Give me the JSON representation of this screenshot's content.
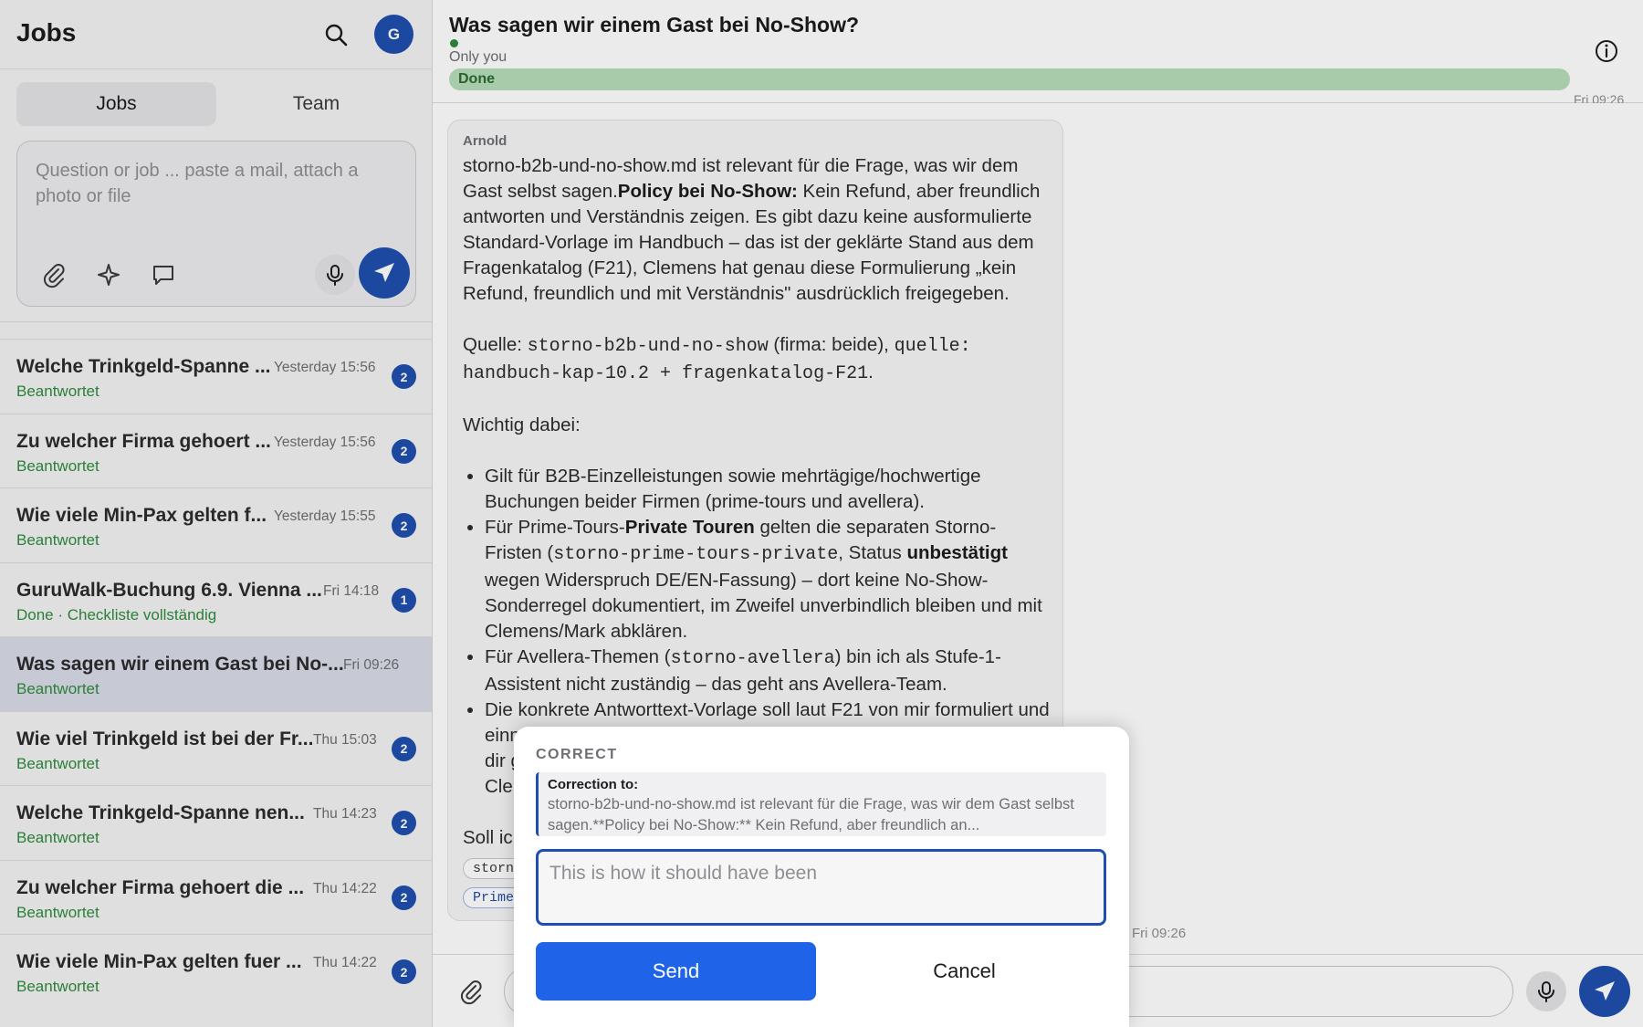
{
  "sidebar": {
    "title": "Jobs",
    "avatar_initial": "G",
    "tabs": [
      {
        "label": "Jobs",
        "active": true
      },
      {
        "label": "Team",
        "active": false
      }
    ],
    "composer": {
      "placeholder": "Question or job ... paste a mail, attach a photo or file"
    },
    "jobs": [
      {
        "title": "Welche Trinkgeld-Spanne ...",
        "time": "Yesterday 15:56",
        "status": "Beantwortet",
        "badge": "2"
      },
      {
        "title": "Zu welcher Firma gehoert ...",
        "time": "Yesterday 15:56",
        "status": "Beantwortet",
        "badge": "2"
      },
      {
        "title": "Wie viele Min-Pax gelten f...",
        "time": "Yesterday 15:55",
        "status": "Beantwortet",
        "badge": "2"
      },
      {
        "title": "GuruWalk-Buchung 6.9. Vienna ...",
        "time": "Fri 14:18",
        "status": "Done · Checkliste vollständig",
        "badge": "1"
      },
      {
        "title": "Was sagen wir einem Gast bei No-...",
        "time": "Fri 09:26",
        "status": "Beantwortet",
        "badge": ""
      },
      {
        "title": "Wie viel Trinkgeld ist bei der Fr...",
        "time": "Thu 15:03",
        "status": "Beantwortet",
        "badge": "2"
      },
      {
        "title": "Welche Trinkgeld-Spanne nen...",
        "time": "Thu 14:23",
        "status": "Beantwortet",
        "badge": "2"
      },
      {
        "title": "Zu welcher Firma gehoert die ...",
        "time": "Thu 14:22",
        "status": "Beantwortet",
        "badge": "2"
      },
      {
        "title": "Wie viele Min-Pax gelten fuer ...",
        "time": "Thu 14:22",
        "status": "Beantwortet",
        "badge": "2"
      }
    ]
  },
  "conversation": {
    "title": "Was sagen wir einem Gast bei No-Show?",
    "visibility": "Only you",
    "status": "Done",
    "message": {
      "author": "Arnold",
      "p1_a": "storno-b2b-und-no-show.md ist relevant für die Frage, was wir dem Gast selbst sagen.",
      "p1_bold": "Policy bei No-Show:",
      "p1_b": " Kein Refund, aber freundlich antworten und Verständnis zeigen. Es gibt dazu keine ausformulierte Standard-Vorlage im Handbuch – das ist der geklärte Stand aus dem Fragenkatalog (F21), Clemens hat genau diese Formulierung „kein Refund, freundlich und mit Verständnis\" ausdrücklich freigegeben.",
      "source_label": "Quelle: ",
      "source_code1": "storno-b2b-und-no-show",
      "source_mid": " (firma: beide), ",
      "source_code2": "quelle: handbuch-kap-10.2 + fragenkatalog-F21",
      "source_end": ".",
      "important": "Wichtig dabei:",
      "b1": "Gilt für B2B-Einzelleistungen sowie mehrtägige/hochwertige Buchungen beider Firmen (prime-tours und avellera).",
      "b2_a": "Für Prime-Tours-",
      "b2_bold1": "Private Touren",
      "b2_b": " gelten die separaten Storno-Fristen (",
      "b2_code": "storno-prime-tours-private",
      "b2_c": ", Status ",
      "b2_bold2": "unbestätigt",
      "b2_d": " wegen Widerspruch DE/EN-Fassung) – dort keine No-Show-Sonderregel dokumentiert, im Zweifel unverbindlich bleiben und mit Clemens/Mark abklären.",
      "b3_a": "Für Avellera-Themen (",
      "b3_code": "storno-avellera",
      "b3_b": ") bin ich als Stufe-1-Assistent nicht zuständig – das geht ans Avellera-Team.",
      "b4": "Die konkrete Antworttext-Vorlage soll laut F21 von mir formuliert und einmal von Clemens freigegeben werden. Falls du willst, mache ich dir gleich einen Entwurf für die Mail an den Gast, den du an Clemens weiterleiten bzw. direkt verwenden kannst.",
      "question": "Soll ich",
      "tag1": "storno",
      "tag2": "Prime"
    },
    "timestamp": "Fri 09:26",
    "timestamp_top": "Fri 09:26"
  },
  "modal": {
    "heading": "CORRECT",
    "quote_label": "Correction to:",
    "quote_text": "storno-b2b-und-no-show.md ist relevant für die Frage, was wir dem Gast selbst sagen.**Policy bei No-Show:** Kein Refund, aber freundlich an...",
    "placeholder": "This is how it should have been",
    "send_label": "Send",
    "cancel_label": "Cancel"
  },
  "colors": {
    "accent": "#1f4fae",
    "send_button": "#1f63e8",
    "status_green": "#2e8b3d",
    "done_bar": "#b7ddb9"
  },
  "icons": [
    "search-icon",
    "paperclip-icon",
    "sparkle-icon",
    "chat-bubble-icon",
    "microphone-icon",
    "send-icon",
    "info-icon"
  ]
}
